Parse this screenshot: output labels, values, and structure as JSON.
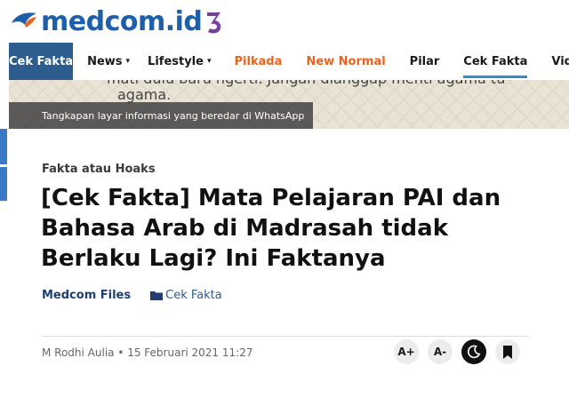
{
  "brand": {
    "name": "medcom.id"
  },
  "nav": {
    "active": "Cek Fakta",
    "items": [
      {
        "label": "News",
        "caret": "▾",
        "style": "normal"
      },
      {
        "label": "Lifestyle",
        "caret": "▾",
        "style": "normal"
      },
      {
        "label": "Pilkada",
        "caret": "",
        "style": "orange"
      },
      {
        "label": "New Normal",
        "caret": "",
        "style": "orange"
      },
      {
        "label": "Pilar",
        "caret": "",
        "style": "normal"
      },
      {
        "label": "Cek Fakta",
        "caret": "",
        "style": "underlined"
      },
      {
        "label": "Vide",
        "caret": "",
        "style": "normal"
      }
    ]
  },
  "hero": {
    "image_text_line1": "mati dulu baru ngerti. Jangan dianggap menti agama tu",
    "image_text_line2": "agama.",
    "caption": "Tangkapan layar informasi yang beredar di WhatsApp"
  },
  "article": {
    "category": "Fakta atau Hoaks",
    "title": "[Cek Fakta] Mata Pelajaran PAI dan Bahasa Arab di Madrasah tidak Berlaku Lagi? Ini Faktanya",
    "source": "Medcom Files",
    "tag": "Cek Fakta",
    "author_date": "M Rodhi Aulia • 15 Februari 2021 11:27"
  },
  "tools": {
    "increase_font": "A+",
    "decrease_font": "A-"
  },
  "colors": {
    "brand_blue": "#1d5fa9",
    "nav_active_bg": "#2d5d8f",
    "orange": "#e8641e"
  }
}
